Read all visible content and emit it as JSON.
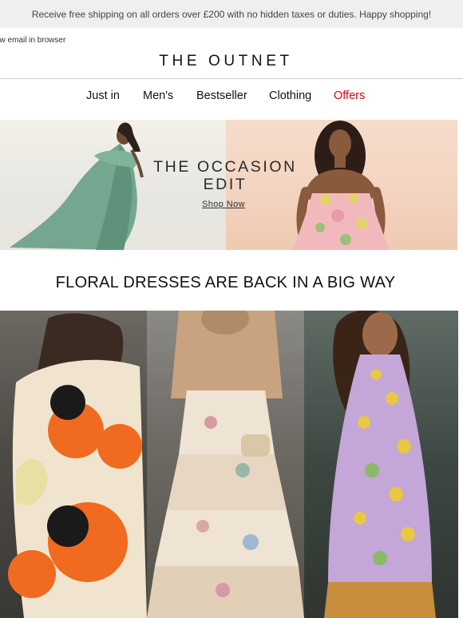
{
  "promo": {
    "text": "Receive free shipping on all orders over £200 with no hidden taxes or duties. Happy shopping!"
  },
  "view_in_browser": "ew email in browser",
  "brand": {
    "logo": "THE OUTNET"
  },
  "nav": {
    "items": [
      {
        "label": "Just in"
      },
      {
        "label": "Men's"
      },
      {
        "label": "Bestseller"
      },
      {
        "label": "Clothing"
      },
      {
        "label": "Offers"
      }
    ],
    "offers_color": "#e10000"
  },
  "hero": {
    "title_line1": "THE OCCASION",
    "title_line2": "EDIT",
    "cta": "Shop Now"
  },
  "section": {
    "headline": "FLORAL DRESSES ARE BACK IN A BIG WAY"
  },
  "colors": {
    "promo_bg": "#efefef",
    "divider": "#cfcfcf"
  }
}
